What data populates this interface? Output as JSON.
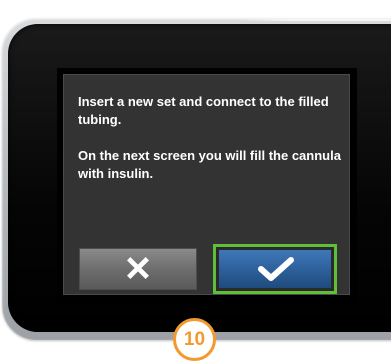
{
  "dialog": {
    "line1": "Insert a new set and connect to the filled tubing.",
    "line2": "On the next screen you will fill the cannula with insulin."
  },
  "buttons": {
    "cancel_icon": "close-x-icon",
    "confirm_icon": "checkmark-icon"
  },
  "step_badge": {
    "number": "10"
  },
  "colors": {
    "dialog_bg": "#333333",
    "confirm_blue": "#2c5f99",
    "confirm_outline_green": "#5fbf3a",
    "cancel_gray": "#6e6e6e",
    "badge_orange": "#f29a2e"
  }
}
